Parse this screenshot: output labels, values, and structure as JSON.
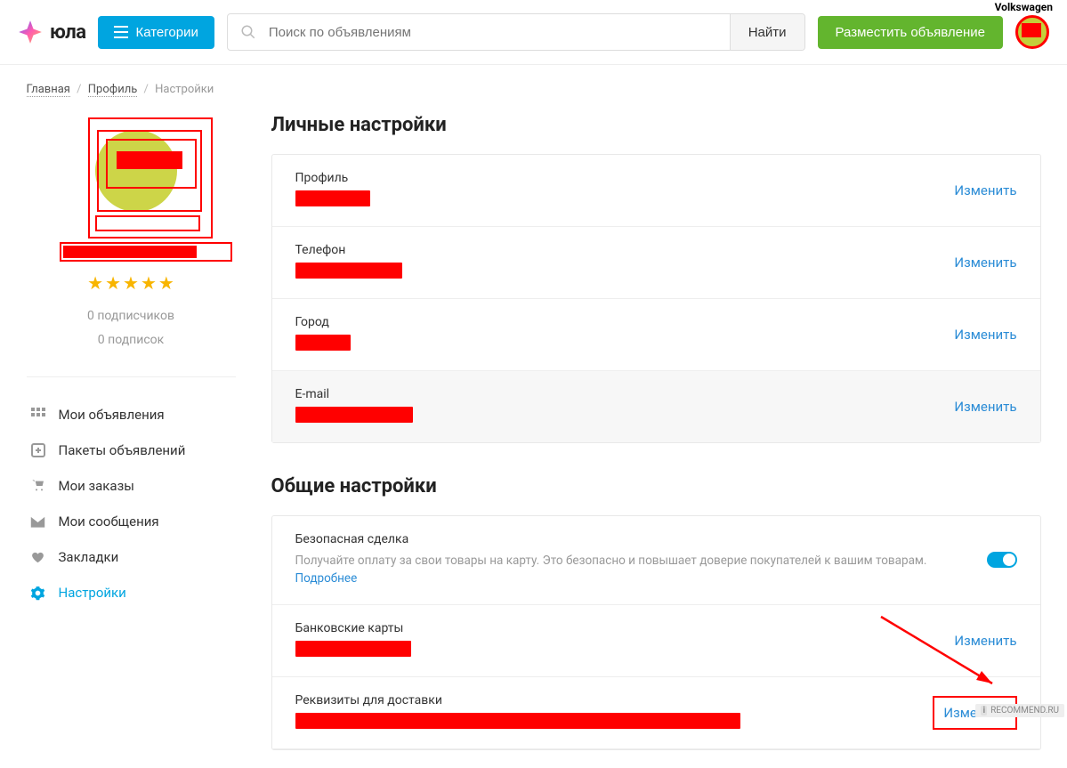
{
  "annot": "Volkswagen",
  "header": {
    "logo_text": "юла",
    "categories": "Категории",
    "search_placeholder": "Поиск по объявлениям",
    "search_btn": "Найти",
    "post_btn": "Разместить объявление"
  },
  "breadcrumb": {
    "home": "Главная",
    "profile": "Профиль",
    "current": "Настройки"
  },
  "sidebar": {
    "followers": "0 подписчиков",
    "subscriptions": "0 подписок",
    "nav": [
      {
        "label": "Мои объявления"
      },
      {
        "label": "Пакеты объявлений"
      },
      {
        "label": "Мои заказы"
      },
      {
        "label": "Мои сообщения"
      },
      {
        "label": "Закладки"
      },
      {
        "label": "Настройки"
      }
    ]
  },
  "main": {
    "personal_title": "Личные настройки",
    "general_title": "Общие настройки",
    "change": "Изменить",
    "rows": {
      "profile": "Профиль",
      "phone": "Телефон",
      "city": "Город",
      "email": "E-mail",
      "safedeal": "Безопасная сделка",
      "safedeal_desc": "Получайте оплату за свои товары на карту. Это безопасно и повышает доверие покупателей к вашим товарам. ",
      "more": "Подробнее",
      "cards": "Банковские карты",
      "delivery": "Реквизиты для доставки"
    }
  },
  "watermark": "RECOMMEND.RU"
}
